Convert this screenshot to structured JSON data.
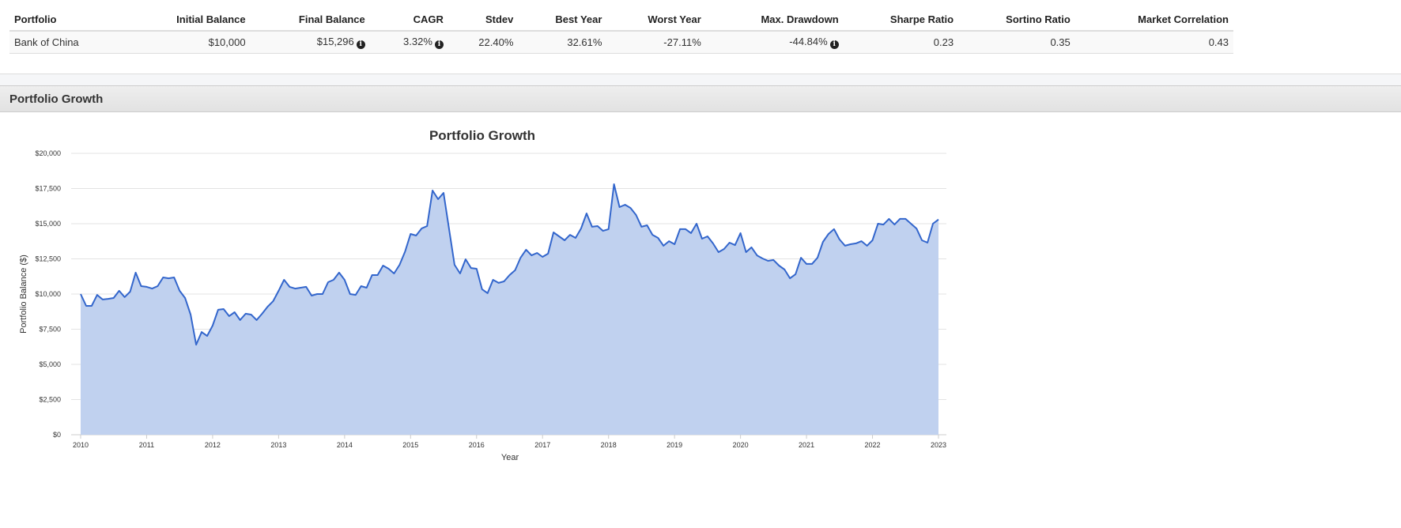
{
  "table": {
    "headers": [
      "Portfolio",
      "Initial Balance",
      "Final Balance",
      "CAGR",
      "Stdev",
      "Best Year",
      "Worst Year",
      "Max. Drawdown",
      "Sharpe Ratio",
      "Sortino Ratio",
      "Market Correlation"
    ],
    "rows": [
      [
        "Bank of China",
        "$10,000",
        "$15,296",
        "3.32%",
        "22.40%",
        "32.61%",
        "-27.11%",
        "-44.84%",
        "0.23",
        "0.35",
        "0.43"
      ]
    ]
  },
  "panel": {
    "title": "Portfolio Growth"
  },
  "chart_data": {
    "type": "area",
    "title": "Portfolio Growth",
    "xlabel": "Year",
    "ylabel": "Portfolio Balance ($)",
    "xlim": [
      2010,
      2023
    ],
    "ylim": [
      0,
      20000
    ],
    "x_ticks": [
      "2010",
      "2011",
      "2012",
      "2013",
      "2014",
      "2015",
      "2016",
      "2017",
      "2018",
      "2019",
      "2020",
      "2021",
      "2022",
      "2023"
    ],
    "y_ticks": [
      "$0",
      "$2,500",
      "$5,000",
      "$7,500",
      "$10,000",
      "$12,500",
      "$15,000",
      "$17,500",
      "$20,000"
    ],
    "grid": true,
    "colors": {
      "line": "#3366cc",
      "fill": "#c0d1ef"
    },
    "values": [
      10000,
      9160,
      9160,
      9940,
      9610,
      9660,
      9720,
      10230,
      9780,
      10170,
      11520,
      10560,
      10510,
      10390,
      10560,
      11180,
      11120,
      11180,
      10230,
      9720,
      8540,
      6400,
      7300,
      7020,
      7750,
      8880,
      8930,
      8430,
      8710,
      8150,
      8600,
      8540,
      8150,
      8600,
      9100,
      9490,
      10230,
      11010,
      10510,
      10390,
      10450,
      10510,
      9890,
      10000,
      10000,
      10840,
      11010,
      11520,
      11010,
      10000,
      9940,
      10560,
      10450,
      11350,
      11350,
      12020,
      11800,
      11460,
      12080,
      13030,
      14270,
      14160,
      14660,
      14830,
      17360,
      16740,
      17190,
      14610,
      12080,
      11460,
      12470,
      11850,
      11800,
      10340,
      10060,
      11010,
      10790,
      10900,
      11350,
      11690,
      12580,
      13150,
      12750,
      12920,
      12640,
      12870,
      14380,
      14100,
      13820,
      14210,
      13990,
      14660,
      15730,
      14780,
      14830,
      14490,
      14610,
      17810,
      16180,
      16350,
      16120,
      15620,
      14780,
      14890,
      14210,
      13990,
      13430,
      13760,
      13540,
      14610,
      14610,
      14330,
      15000,
      13930,
      14100,
      13600,
      12980,
      13200,
      13650,
      13480,
      14330,
      12980,
      13320,
      12750,
      12530,
      12360,
      12420,
      12020,
      11740,
      11120,
      11410,
      12580,
      12140,
      12140,
      12580,
      13710,
      14270,
      14610,
      13880,
      13430,
      13540,
      13600,
      13760,
      13430,
      13820,
      15000,
      14940,
      15340,
      14940,
      15340,
      15340,
      15000,
      14660,
      13820,
      13650,
      15000,
      15296
    ]
  }
}
